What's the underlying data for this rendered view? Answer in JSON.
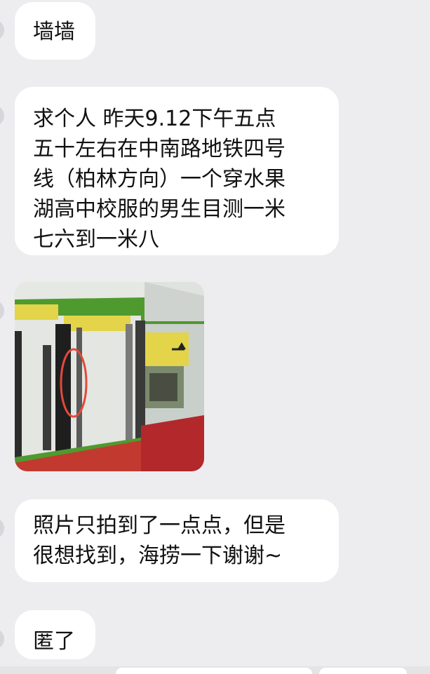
{
  "messages": [
    {
      "lines": [
        "墙墙"
      ]
    },
    {
      "lines": [
        "求个人 昨天9.12下午五点",
        "五十左右在中南路地铁四号",
        "线（柏林方向）一个穿水果",
        "湖高中校服的男生目测一米",
        "七六到一米八"
      ]
    },
    {
      "type": "image",
      "icon": "subway-photo"
    },
    {
      "lines": [
        "照片只拍到了一点点，但是",
        "很想找到，海捞一下谢谢~"
      ]
    },
    {
      "lines": [
        "匿了"
      ]
    }
  ],
  "colors": {
    "background": "#ededf0",
    "bubble": "#ffffff",
    "text": "#111111",
    "train_green": "#4f9a2f",
    "train_red": "#b2282b",
    "sign_yellow": "#e3d44a",
    "circle_annotation": "#e24a3a"
  }
}
